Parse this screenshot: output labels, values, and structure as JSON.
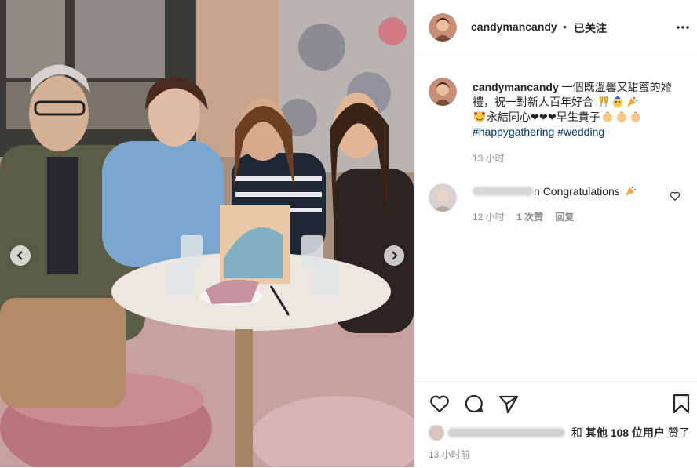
{
  "post": {
    "username": "candymancandy",
    "dot": "•",
    "follow_status": "已关注",
    "more_icon": "more-horizontal-icon",
    "caption": {
      "username": "candymancandy",
      "line1": "一個既溫馨又甜蜜的婚禮，祝一對新人百年好合",
      "line2a": "永結同心",
      "line2b": "早生貴子",
      "hashtag1": "#happygathering",
      "hashtag2": "#wedding",
      "time": "13 小时"
    },
    "comment": {
      "username_tail": "n",
      "text": "Congratulations",
      "time": "12 小时",
      "likes": "1 次赞",
      "reply": "回复"
    },
    "likes_text_prefix": "和",
    "likes_bold": "其他 108 位用户",
    "likes_suffix": "赞了",
    "post_time": "13 小时前"
  },
  "photo": {
    "prev_icon": "chevron-left-icon",
    "next_icon": "chevron-right-icon"
  },
  "actions": {
    "like_icon": "heart-icon",
    "comment_icon": "comment-icon",
    "share_icon": "share-icon",
    "save_icon": "bookmark-icon"
  },
  "colors": {
    "hashtag": "#00376b",
    "muted": "#8e8e8e",
    "text": "#262626"
  }
}
